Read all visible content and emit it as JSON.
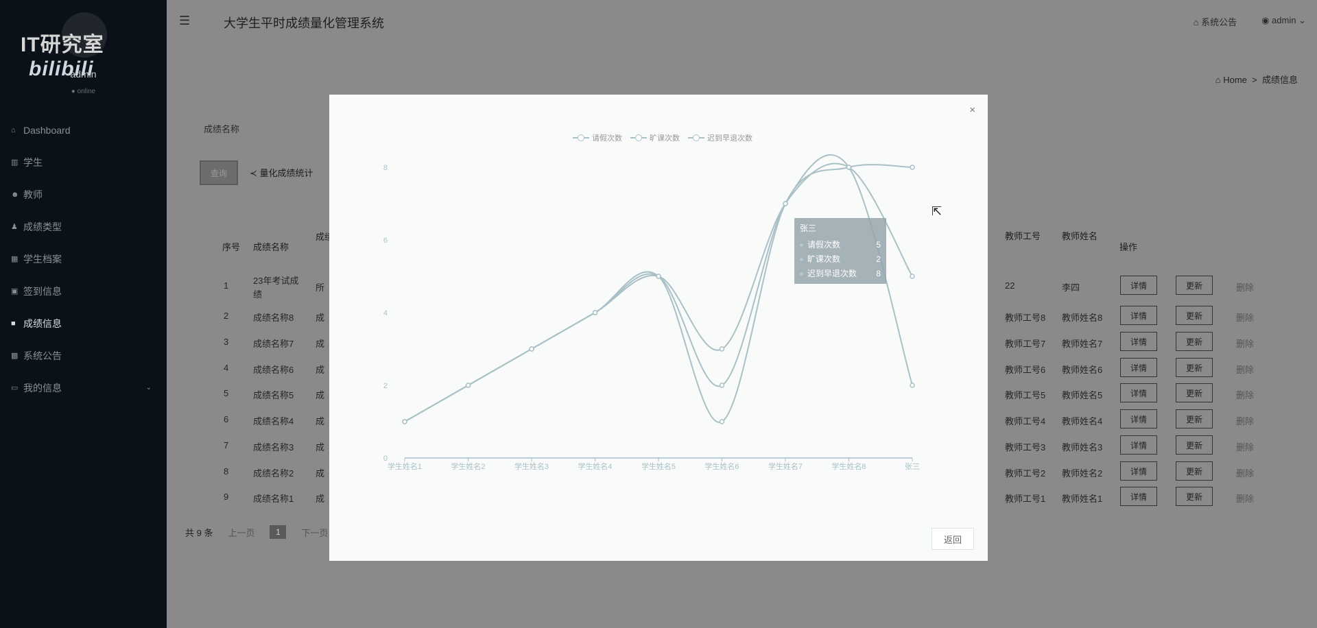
{
  "watermark": {
    "left_text": "IT研究室",
    "right_text": "bilibili"
  },
  "user": {
    "name": "admin",
    "status": "● online"
  },
  "sidebar": {
    "items": [
      {
        "label": "Dashboard",
        "icon": "dashboard-icon",
        "active": false
      },
      {
        "label": "学生",
        "icon": "bar-chart-icon",
        "active": false
      },
      {
        "label": "教师",
        "icon": "users-icon",
        "active": false
      },
      {
        "label": "成绩类型",
        "icon": "user-icon",
        "active": false
      },
      {
        "label": "学生档案",
        "icon": "grid-icon",
        "active": false
      },
      {
        "label": "签到信息",
        "icon": "table-icon",
        "active": false
      },
      {
        "label": "成绩信息",
        "icon": "cube-icon",
        "active": true
      },
      {
        "label": "系统公告",
        "icon": "apps-icon",
        "active": false
      },
      {
        "label": "我的信息",
        "icon": "folder-icon",
        "active": false,
        "expandable": true
      }
    ]
  },
  "header": {
    "title": "大学生平时成绩量化管理系统",
    "notice": "系统公告",
    "account": "admin"
  },
  "breadcrumb": {
    "home": "Home",
    "separator": ">",
    "current": "成绩信息"
  },
  "filter": {
    "label": "成绩名称"
  },
  "toolbar": {
    "search": "查询",
    "stats": "量化成绩统计"
  },
  "table": {
    "headers": {
      "index": "序号",
      "name": "成绩名称",
      "type": "成绩",
      "teacher_id": "教师工号",
      "teacher_name": "教师姓名",
      "action": "操作"
    },
    "rows": [
      {
        "index": "1",
        "name": "23年考试成绩",
        "type": "所",
        "teacher_id": "22",
        "teacher_name": "李四"
      },
      {
        "index": "2",
        "name": "成绩名称8",
        "type": "成",
        "teacher_id": "教师工号8",
        "teacher_name": "教师姓名8"
      },
      {
        "index": "3",
        "name": "成绩名称7",
        "type": "成",
        "teacher_id": "教师工号7",
        "teacher_name": "教师姓名7"
      },
      {
        "index": "4",
        "name": "成绩名称6",
        "type": "成",
        "teacher_id": "教师工号6",
        "teacher_name": "教师姓名6"
      },
      {
        "index": "5",
        "name": "成绩名称5",
        "type": "成",
        "teacher_id": "教师工号5",
        "teacher_name": "教师姓名5"
      },
      {
        "index": "6",
        "name": "成绩名称4",
        "type": "成",
        "teacher_id": "教师工号4",
        "teacher_name": "教师姓名4"
      },
      {
        "index": "7",
        "name": "成绩名称3",
        "type": "成",
        "teacher_id": "教师工号3",
        "teacher_name": "教师姓名3"
      },
      {
        "index": "8",
        "name": "成绩名称2",
        "type": "成",
        "teacher_id": "教师工号2",
        "teacher_name": "教师姓名2"
      },
      {
        "index": "9",
        "name": "成绩名称1",
        "type": "成",
        "teacher_id": "教师工号1",
        "teacher_name": "教师姓名1"
      }
    ],
    "actions": {
      "detail": "详情",
      "update": "更新",
      "delete": "删除"
    }
  },
  "pagination": {
    "total": "共 9 条",
    "prev": "上一页",
    "current": "1",
    "next": "下一页"
  },
  "modal": {
    "close": "×",
    "back": "返回"
  },
  "tooltip": {
    "title": "张三",
    "rows": [
      {
        "label": "请假次数",
        "value": "5"
      },
      {
        "label": "旷课次数",
        "value": "2"
      },
      {
        "label": "迟到早退次数",
        "value": "8"
      }
    ]
  },
  "chart_data": {
    "type": "line",
    "smooth": true,
    "categories": [
      "学生姓名1",
      "学生姓名2",
      "学生姓名3",
      "学生姓名4",
      "学生姓名5",
      "学生姓名6",
      "学生姓名7",
      "学生姓名8",
      "张三"
    ],
    "series": [
      {
        "name": "请假次数",
        "values": [
          1,
          2,
          3,
          4,
          5,
          3,
          7,
          8,
          5
        ]
      },
      {
        "name": "旷课次数",
        "values": [
          1,
          2,
          3,
          4,
          5,
          2,
          7,
          8,
          2
        ]
      },
      {
        "name": "迟到早退次数",
        "values": [
          1,
          2,
          3,
          4,
          5,
          1,
          7,
          8,
          8
        ]
      }
    ],
    "ylim": [
      0,
      8
    ],
    "yticks": [
      "0",
      "2",
      "4",
      "6",
      "8"
    ],
    "legend": "top-center",
    "line_color": "#a9c0c6"
  }
}
